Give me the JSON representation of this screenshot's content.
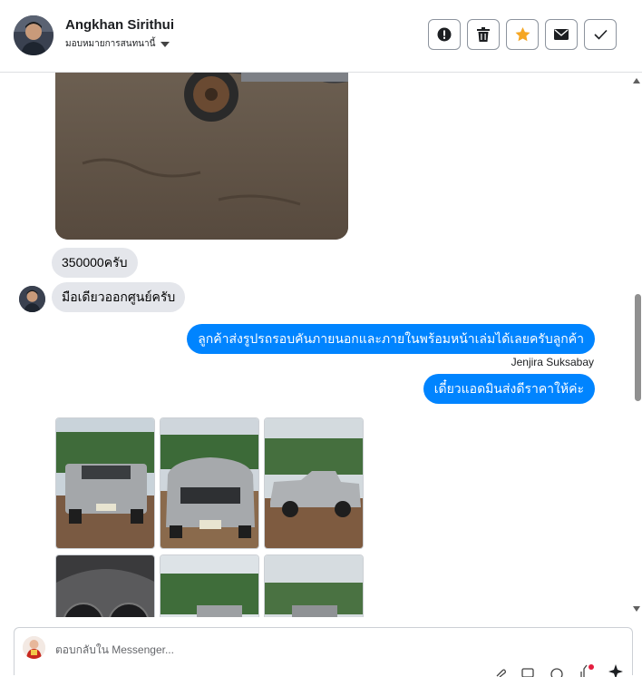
{
  "header": {
    "contact_name": "Angkhan Sirithui",
    "assign_label": "มอบหมายการสนทนานี้",
    "buttons": [
      {
        "name": "spam-button",
        "icon": "alert-icon"
      },
      {
        "name": "delete-button",
        "icon": "trash-icon"
      },
      {
        "name": "star-button",
        "icon": "star-icon"
      },
      {
        "name": "unread-button",
        "icon": "envelope-icon"
      },
      {
        "name": "done-button",
        "icon": "check-icon"
      }
    ]
  },
  "messages": {
    "incoming": [
      {
        "text": "350000ครับ"
      },
      {
        "text": "มือเดียวออกศูนย์ครับ"
      }
    ],
    "outgoing": [
      {
        "text": "ลูกค้าส่งรูปรถรอบคันภายนอกและภายในพร้อมหน้าเล่มได้เลยครับลูกค้า"
      },
      {
        "text": "เดี๋ยวแอดมินส่งดีราคาให้ค่ะ"
      }
    ],
    "outgoing_sender": "Jenjira Suksabay"
  },
  "composer": {
    "placeholder": "ตอบกลับใน Messenger..."
  },
  "colors": {
    "outgoing_bubble": "#0084ff",
    "incoming_bubble": "#e4e6eb",
    "star": "#f5a623"
  }
}
